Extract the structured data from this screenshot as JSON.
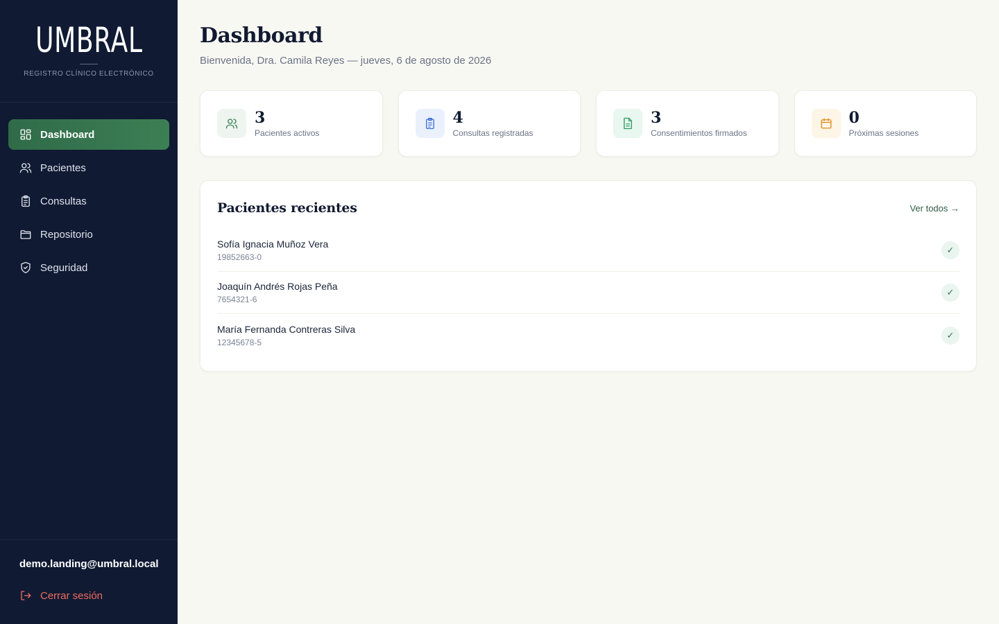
{
  "brand": {
    "name": "UMBRAL",
    "subtitle": "REGISTRO CLÍNICO ELECTRÓNICO"
  },
  "sidebar": {
    "items": [
      {
        "label": "Dashboard",
        "icon": "dashboard-grid-icon",
        "active": true
      },
      {
        "label": "Pacientes",
        "icon": "users-icon",
        "active": false
      },
      {
        "label": "Consultas",
        "icon": "clipboard-icon",
        "active": false
      },
      {
        "label": "Repositorio",
        "icon": "folder-icon",
        "active": false
      },
      {
        "label": "Seguridad",
        "icon": "shield-check-icon",
        "active": false
      }
    ],
    "user_email": "demo.landing@umbral.local",
    "logout_label": "Cerrar sesión"
  },
  "header": {
    "title": "Dashboard",
    "subtitle": "Bienvenida, Dra. Camila Reyes — jueves, 6 de agosto de 2026"
  },
  "stats": [
    {
      "value": "3",
      "label": "Pacientes activos",
      "icon": "users-icon",
      "color": "#3d7f55",
      "bg": "#eef5f0"
    },
    {
      "value": "4",
      "label": "Consultas registradas",
      "icon": "clipboard-icon",
      "color": "#3b6fd4",
      "bg": "#eaf1fd"
    },
    {
      "value": "3",
      "label": "Consentimientos firmados",
      "icon": "document-icon",
      "color": "#2f9a63",
      "bg": "#e8f7ef"
    },
    {
      "value": "0",
      "label": "Próximas sesiones",
      "icon": "calendar-icon",
      "color": "#e08a1e",
      "bg": "#fdf5e6"
    }
  ],
  "recent": {
    "title": "Pacientes recientes",
    "view_all": "Ver todos →",
    "patients": [
      {
        "name": "Sofía Ignacia Muñoz Vera",
        "id": "19852663-0",
        "status": "✓"
      },
      {
        "name": "Joaquín Andrés Rojas Peña",
        "id": "7654321-6",
        "status": "✓"
      },
      {
        "name": "María Fernanda Contreras Silva",
        "id": "12345678-5",
        "status": "✓"
      }
    ]
  },
  "colors": {
    "sidebar_bg": "#101a33",
    "accent": "#3d7f55",
    "danger": "#ef6a5d",
    "page_bg": "#f8f8f3"
  }
}
